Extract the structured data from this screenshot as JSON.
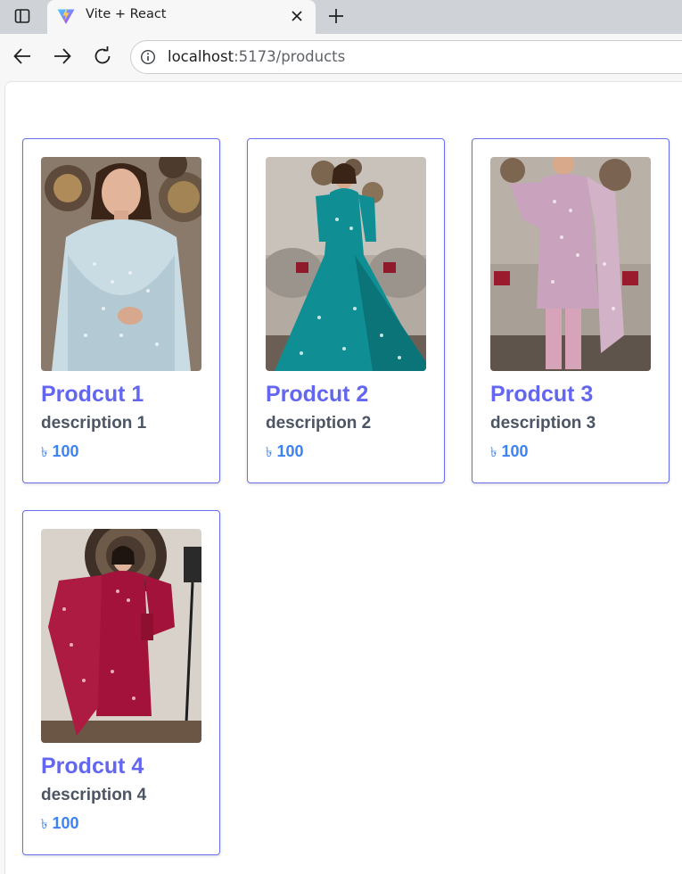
{
  "browser": {
    "tab_title": "Vite + React",
    "url_host": "localhost",
    "url_path": ":5173/products"
  },
  "products": [
    {
      "title": "Prodcut 1",
      "description": "description 1",
      "currency": "৳",
      "price": "100",
      "image": "light-blue-embroidered-suit-photo",
      "dress_color": "#c9dbe3"
    },
    {
      "title": "Prodcut 2",
      "description": "description 2",
      "currency": "৳",
      "price": "100",
      "image": "teal-embroidered-gown-photo",
      "dress_color": "#0f8f94"
    },
    {
      "title": "Prodcut 3",
      "description": "description 3",
      "currency": "৳",
      "price": "100",
      "image": "lilac-embroidered-suit-photo",
      "dress_color": "#c9a3bd"
    },
    {
      "title": "Prodcut 4",
      "description": "description 4",
      "currency": "৳",
      "price": "100",
      "image": "maroon-embroidered-suit-photo",
      "dress_color": "#a3123a"
    }
  ],
  "colors": {
    "title": "#6366f1",
    "description": "#4b5563",
    "price": "#3b82f6",
    "card_border": "#6a6ef0"
  }
}
